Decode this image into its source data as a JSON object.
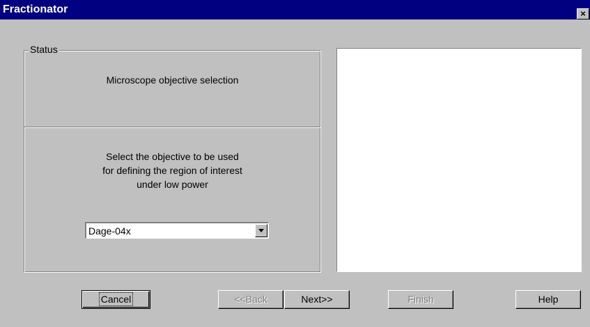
{
  "window": {
    "title": "Fractionator",
    "close_glyph": "×"
  },
  "status_group": {
    "label": "Status",
    "status_text": "Microscope objective selection",
    "instruction_lines": [
      "Select the objective to be used",
      "for defining the region of interest",
      "under low power"
    ]
  },
  "objective_select": {
    "value": "Dage-04x",
    "arrow_icon": "triangle-down-icon"
  },
  "buttons": {
    "cancel": "Cancel",
    "back": "<<Back",
    "next": "Next>>",
    "finish": "Finish",
    "help": "Help"
  },
  "colors": {
    "titlebar": "#000080",
    "face": "#c0c0c0",
    "panel": "#ffffff"
  }
}
